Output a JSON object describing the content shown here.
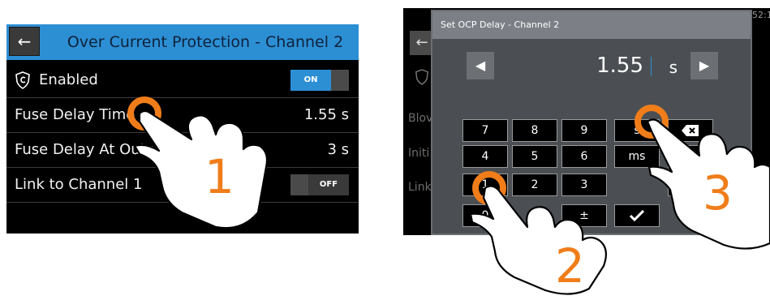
{
  "left_screen": {
    "back_icon": "arrow-left-icon",
    "title": "Over Current Protection - Channel 2",
    "rows": [
      {
        "label": "Enabled",
        "icon": "shield-icon",
        "toggle": "ON"
      },
      {
        "label": "Fuse Delay Time",
        "value": "1.55 s"
      },
      {
        "label": "Fuse Delay At Output-On",
        "value": "3 s"
      },
      {
        "label": "Link to Channel 1",
        "toggle": "OFF"
      }
    ]
  },
  "right_screen": {
    "background_rows": [
      "Blov",
      "Initi",
      "Link"
    ],
    "clock_fragment": "52:1",
    "dialog": {
      "title": "Set OCP Delay - Channel 2",
      "value": "1.55",
      "unit": "s",
      "keys": {
        "k7": "7",
        "k8": "8",
        "k9": "9",
        "kS": "s",
        "k4": "4",
        "k5": "5",
        "k6": "6",
        "kMs": "ms",
        "k1": "1",
        "k2": "2",
        "k3": "3",
        "k0": "0",
        "kPm": "±"
      }
    }
  },
  "annotations": {
    "step1": "1",
    "step2": "2",
    "step3": "3",
    "accent_color": "#f07d1a",
    "header_color": "#2c8fd4"
  }
}
